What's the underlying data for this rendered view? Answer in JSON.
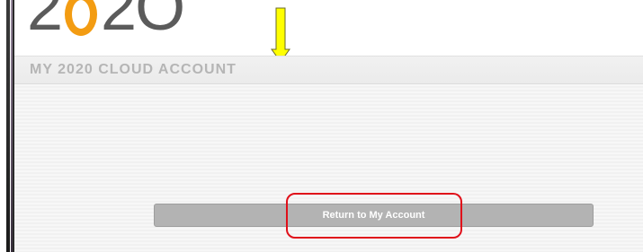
{
  "logo": {
    "char_1": "2",
    "char_3": "2",
    "char_4": "O"
  },
  "header": {
    "title": "MY 2020 CLOUD ACCOUNT"
  },
  "main": {
    "return_button_label": "Return to My Account"
  },
  "colors": {
    "logo_gray": "#5b5b5b",
    "logo_accent": "#f39c12",
    "annotation_arrow": "#ffff00",
    "annotation_box": "#e0101a",
    "button_bg": "#b3b3b3"
  },
  "annotations": {
    "arrow": "down-arrow-icon",
    "highlight": "red-rounded-rectangle"
  }
}
